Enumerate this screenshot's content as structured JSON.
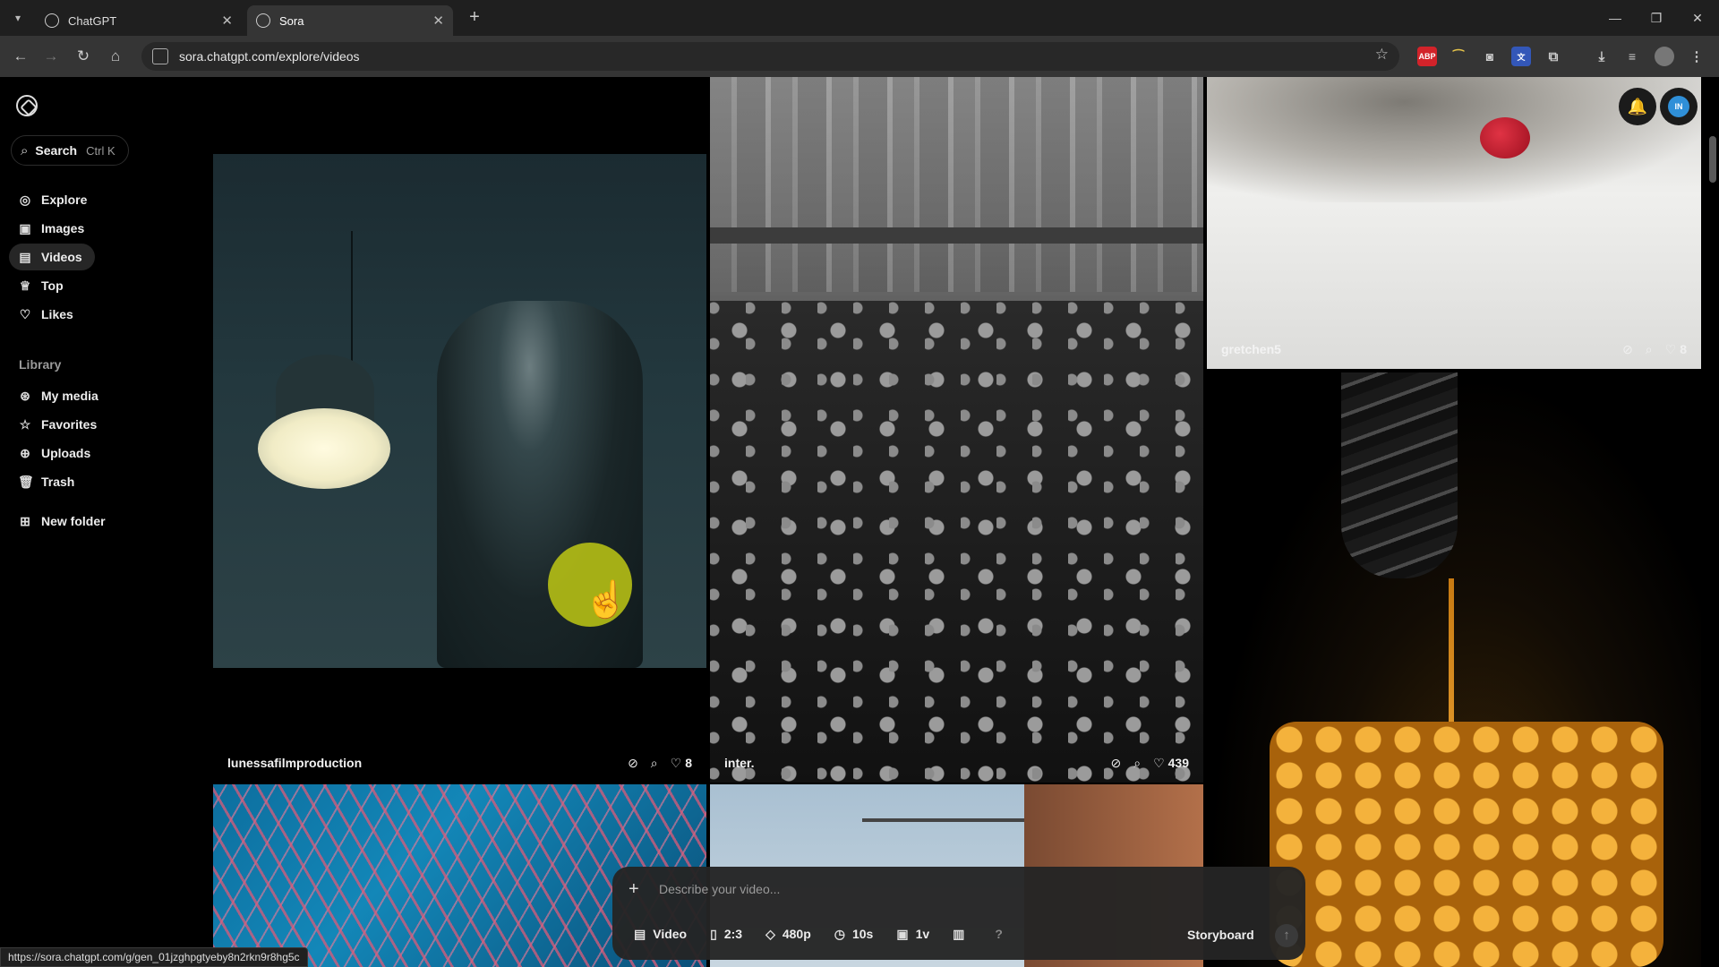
{
  "browser": {
    "tabs": [
      {
        "title": "ChatGPT"
      },
      {
        "title": "Sora"
      }
    ],
    "url": "sora.chatgpt.com/explore/videos",
    "status_url": "https://sora.chatgpt.com/g/gen_01jzghpgtyeby8n2rkn9r8hg5c"
  },
  "sidebar": {
    "search_label": "Search",
    "search_shortcut": "Ctrl K",
    "nav": [
      {
        "label": "Explore",
        "icon": "compass-icon"
      },
      {
        "label": "Images",
        "icon": "image-icon"
      },
      {
        "label": "Videos",
        "icon": "video-icon"
      },
      {
        "label": "Top",
        "icon": "trophy-icon"
      },
      {
        "label": "Likes",
        "icon": "heart-icon"
      }
    ],
    "library_label": "Library",
    "library": [
      {
        "label": "My media",
        "icon": "media-icon"
      },
      {
        "label": "Favorites",
        "icon": "star-icon"
      },
      {
        "label": "Uploads",
        "icon": "upload-icon"
      },
      {
        "label": "Trash",
        "icon": "trash-icon"
      }
    ],
    "new_folder": "New folder"
  },
  "feed": [
    {
      "author": "lunessafilmproduction",
      "likes": "8"
    },
    {
      "author": "inter.",
      "likes": "439"
    },
    {
      "author": "gretchen5",
      "likes": "8"
    }
  ],
  "composer": {
    "placeholder": "Describe your video...",
    "type": "Video",
    "aspect": "2:3",
    "resolution": "480p",
    "duration": "10s",
    "variations": "1v",
    "storyboard": "Storyboard"
  },
  "user": {
    "initials": "IN"
  }
}
